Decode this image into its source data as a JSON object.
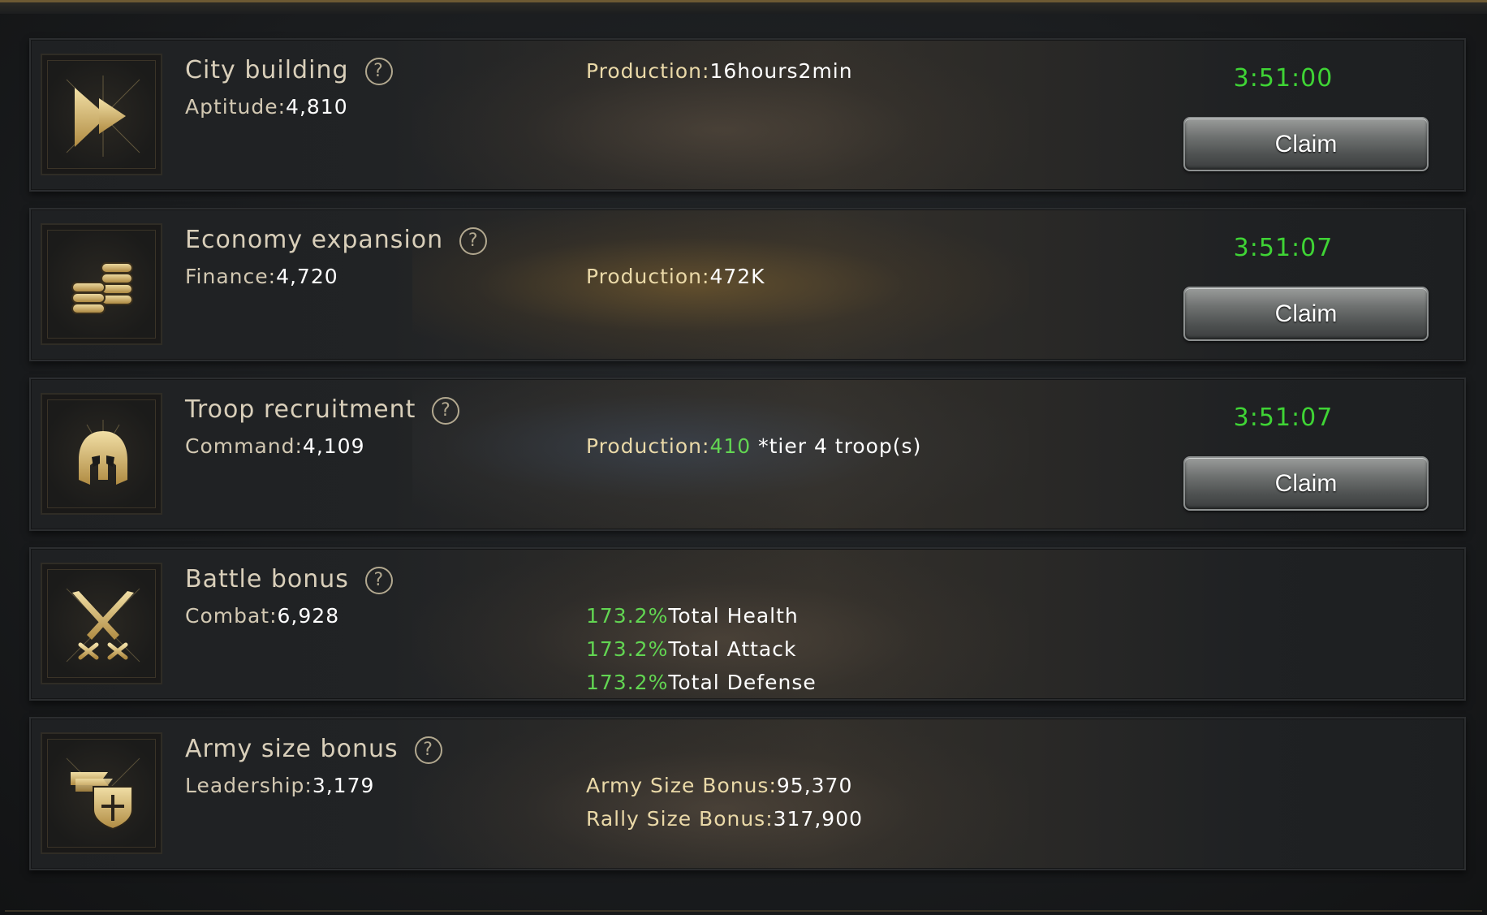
{
  "rows": [
    {
      "title": "City building",
      "stat_label": "Aptitude:",
      "stat_value": "4,810",
      "production_label": "Production:",
      "production_value": "16hours2min",
      "timer": "3:51:00",
      "claim_label": "Claim",
      "icon": "fast-forward-icon"
    },
    {
      "title": "Economy expansion",
      "stat_label": "Finance:",
      "stat_value": "4,720",
      "production_label": "Production:",
      "production_value": "472K",
      "timer": "3:51:07",
      "claim_label": "Claim",
      "icon": "gold-coins-icon"
    },
    {
      "title": "Troop recruitment",
      "stat_label": "Command:",
      "stat_value": "4,109",
      "production_label": "Production:",
      "production_value": "410",
      "production_suffix": " *tier 4 troop(s)",
      "timer": "3:51:07",
      "claim_label": "Claim",
      "icon": "spartan-helmet-icon"
    },
    {
      "title": "Battle bonus",
      "stat_label": "Combat:",
      "stat_value": "6,928",
      "bonuses": [
        {
          "value": "173.2%",
          "label": "Total Health"
        },
        {
          "value": "173.2%",
          "label": "Total Attack"
        },
        {
          "value": "173.2%",
          "label": "Total Defense"
        }
      ],
      "icon": "crossed-swords-icon"
    },
    {
      "title": "Army size bonus",
      "stat_label": "Leadership:",
      "stat_value": "3,179",
      "army_size_label": "Army Size Bonus:",
      "army_size_value": "95,370",
      "rally_size_label": "Rally Size Bonus:",
      "rally_size_value": "317,900",
      "icon": "banner-shield-icon"
    }
  ],
  "help_glyph": "?",
  "colors": {
    "timer_green": "#3fd435",
    "bonus_green": "#62d552",
    "production_gold": "#ead9a8",
    "icon_gold": "#d8bd78"
  }
}
